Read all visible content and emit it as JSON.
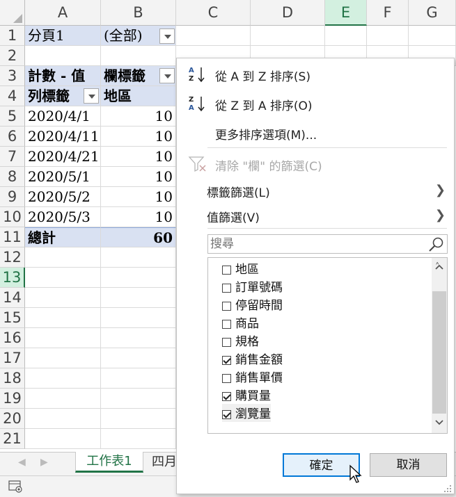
{
  "columns": [
    "A",
    "B",
    "C",
    "D",
    "E",
    "F",
    "G"
  ],
  "rows": [
    "1",
    "2",
    "3",
    "4",
    "5",
    "6",
    "7",
    "8",
    "9",
    "10",
    "11",
    "12",
    "13",
    "14",
    "15",
    "16",
    "17",
    "18",
    "19",
    "20",
    "21"
  ],
  "cells": {
    "a1": "分頁1",
    "b1": "(全部)",
    "a3": "計數 - 值",
    "b3": "欄標籤",
    "a4": "列標籤",
    "b4": "地區",
    "a5": "2020/4/1",
    "b5": "10",
    "a6": "2020/4/11",
    "b6": "10",
    "a7": "2020/4/21",
    "b7": "10",
    "a8": "2020/5/1",
    "b8": "10",
    "a9": "2020/5/2",
    "b9": "10",
    "a10": "2020/5/3",
    "b10": "10",
    "a11": "總計",
    "b11": "60"
  },
  "sheet_tabs": [
    "工作表1",
    "四月"
  ],
  "menu": {
    "sort_az": "從 A 到 Z 排序(S)",
    "sort_za": "從 Z 到 A 排序(O)",
    "more_sort": "更多排序選項(M)...",
    "clear_filter": "清除 \"欄\" 的篩選(C)",
    "label_filter": "標籤篩選(L)",
    "value_filter": "值篩選(V)",
    "search_placeholder": "搜尋",
    "ok": "確定",
    "cancel": "取消"
  },
  "list_items": [
    {
      "label": "地區",
      "checked": false
    },
    {
      "label": "訂單號碼",
      "checked": false
    },
    {
      "label": "停留時間",
      "checked": false
    },
    {
      "label": "商品",
      "checked": false
    },
    {
      "label": "規格",
      "checked": false
    },
    {
      "label": "銷售金額",
      "checked": true
    },
    {
      "label": "銷售單價",
      "checked": false
    },
    {
      "label": "購買量",
      "checked": true
    },
    {
      "label": "瀏覽量",
      "checked": true
    }
  ],
  "colors": {
    "pivot_blue": "#d9e1f2",
    "excel_green": "#217346",
    "accent": "#0078d7"
  }
}
